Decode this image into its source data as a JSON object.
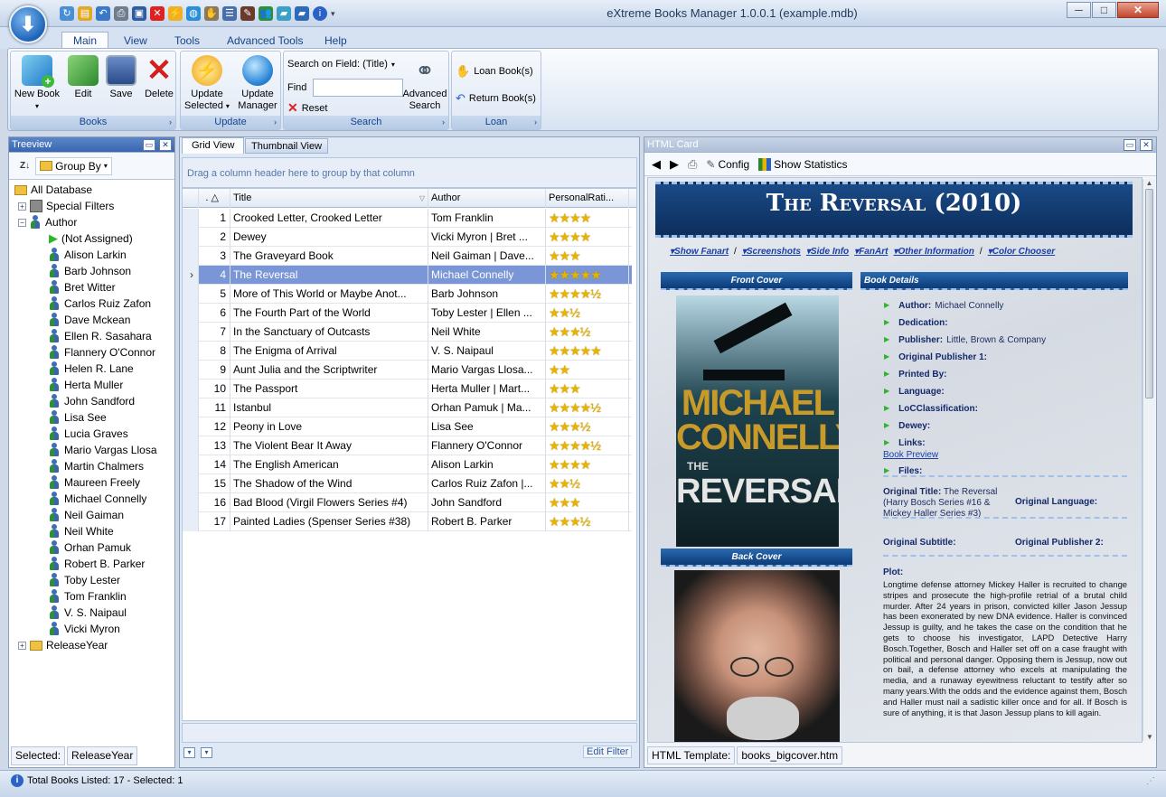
{
  "window": {
    "title": "eXtreme Books Manager 1.0.0.1 (example.mdb)",
    "minimize": "─",
    "maximize": "□",
    "close": "✕"
  },
  "ribbon": {
    "tabs": [
      "Main",
      "View",
      "Tools",
      "Advanced Tools",
      "Help"
    ],
    "groups": {
      "books": {
        "caption": "Books",
        "new_book": "New Book",
        "edit": "Edit",
        "save": "Save",
        "delete": "Delete"
      },
      "update": {
        "caption": "Update",
        "update_selected": "Update Selected",
        "update_manager": "Update Manager"
      },
      "search": {
        "caption": "Search",
        "field_label": "Search on Field: (Title)",
        "find_label": "Find",
        "find_value": "",
        "reset": "Reset",
        "advanced_search": "Advanced Search"
      },
      "loan": {
        "caption": "Loan",
        "loan_books": "Loan Book(s)",
        "return_books": "Return Book(s)"
      }
    }
  },
  "treeview": {
    "title": "Treeview",
    "group_by": "Group By",
    "nodes": {
      "all": "All Database",
      "special": "Special Filters",
      "author": "Author",
      "release": "ReleaseYear"
    },
    "authors": [
      "(Not Assigned)",
      "Alison Larkin",
      "Barb Johnson",
      "Bret Witter",
      "Carlos Ruiz Zafon",
      "Dave Mckean",
      "Ellen R. Sasahara",
      "Flannery O'Connor",
      "Helen R. Lane",
      "Herta Muller",
      "John Sandford",
      "Lisa See",
      "Lucia Graves",
      "Mario Vargas Llosa",
      "Martin Chalmers",
      "Maureen Freely",
      "Michael Connelly",
      "Neil Gaiman",
      "Neil White",
      "Orhan Pamuk",
      "Robert B. Parker",
      "Toby Lester",
      "Tom Franklin",
      "V. S. Naipaul",
      "Vicki Myron"
    ],
    "selected_label": "Selected:",
    "selected_value": "ReleaseYear"
  },
  "grid": {
    "tabs": [
      "Grid View",
      "Thumbnail View"
    ],
    "group_hint": "Drag a column header here to group by that column",
    "headers": {
      "num": ". △",
      "title": "Title",
      "author": "Author",
      "rating": "PersonalRati..."
    },
    "rows": [
      {
        "n": "1",
        "title": "Crooked Letter, Crooked Letter",
        "author": "Tom Franklin",
        "rating": "★★★★"
      },
      {
        "n": "2",
        "title": "Dewey",
        "author": "Vicki Myron | Bret ...",
        "rating": "★★★★"
      },
      {
        "n": "3",
        "title": "The Graveyard Book",
        "author": "Neil Gaiman | Dave...",
        "rating": "★★★"
      },
      {
        "n": "4",
        "title": "The Reversal",
        "author": "Michael Connelly",
        "rating": "★★★★★"
      },
      {
        "n": "5",
        "title": "More of This World or Maybe Anot...",
        "author": "Barb Johnson",
        "rating": "★★★★½"
      },
      {
        "n": "6",
        "title": "The Fourth Part of the World",
        "author": "Toby Lester | Ellen ...",
        "rating": "★★½"
      },
      {
        "n": "7",
        "title": "In the Sanctuary of Outcasts",
        "author": "Neil White",
        "rating": "★★★½"
      },
      {
        "n": "8",
        "title": "The Enigma of Arrival",
        "author": "V. S. Naipaul",
        "rating": "★★★★★"
      },
      {
        "n": "9",
        "title": "Aunt Julia and the Scriptwriter",
        "author": "Mario Vargas Llosa...",
        "rating": "★★"
      },
      {
        "n": "10",
        "title": "The Passport",
        "author": "Herta Muller | Mart...",
        "rating": "★★★"
      },
      {
        "n": "11",
        "title": "Istanbul",
        "author": "Orhan Pamuk | Ma...",
        "rating": "★★★★½"
      },
      {
        "n": "12",
        "title": "Peony in Love",
        "author": "Lisa See",
        "rating": "★★★½"
      },
      {
        "n": "13",
        "title": "The Violent Bear It Away",
        "author": "Flannery O'Connor",
        "rating": "★★★★½"
      },
      {
        "n": "14",
        "title": "The English American",
        "author": "Alison Larkin",
        "rating": "★★★★"
      },
      {
        "n": "15",
        "title": "The Shadow of the Wind",
        "author": "Carlos Ruiz Zafon |...",
        "rating": "★★½"
      },
      {
        "n": "16",
        "title": "Bad Blood (Virgil Flowers Series #4)",
        "author": "John Sandford",
        "rating": "★★★"
      },
      {
        "n": "17",
        "title": "Painted Ladies (Spenser Series #38)",
        "author": "Robert B. Parker",
        "rating": "★★★½"
      }
    ],
    "edit_filter": "Edit Filter"
  },
  "card": {
    "title": "HTML Card",
    "config": "Config",
    "show_statistics": "Show Statistics",
    "book_title": "The Reversal (2010)",
    "links": [
      "Show Fanart",
      "Screenshots",
      "Side Info",
      "FanArt",
      "Other Information",
      "Color Chooser"
    ],
    "front_cover": "Front Cover",
    "back_cover": "Back Cover",
    "cover_author": "MICHAEL CONNELLY",
    "cover_title": "REVERSAL",
    "cover_the": "THE",
    "book_details": "Book Details",
    "details": [
      {
        "label": "Author:",
        "value": "Michael Connelly"
      },
      {
        "label": "Dedication:",
        "value": ""
      },
      {
        "label": "Publisher:",
        "value": "Little, Brown & Company"
      },
      {
        "label": "Original Publisher 1:",
        "value": ""
      },
      {
        "label": "Printed By:",
        "value": ""
      },
      {
        "label": "Language:",
        "value": ""
      },
      {
        "label": "LoCClassification:",
        "value": ""
      },
      {
        "label": "Dewey:",
        "value": ""
      },
      {
        "label": "Links:",
        "value": ""
      }
    ],
    "book_preview": "Book Preview",
    "files": "Files:",
    "orig_title_label": "Original Title:",
    "orig_title_value": "The Reversal (Harry Bosch Series #16 & Mickey Haller Series #3)",
    "orig_language": "Original Language:",
    "orig_subtitle": "Original Subtitle:",
    "orig_publisher2": "Original Publisher 2:",
    "plot_label": "Plot:",
    "plot": "Longtime defense attorney Mickey Haller is recruited to change stripes and prosecute the high-profile retrial of a brutal child murder. After 24 years in prison, convicted killer Jason Jessup has been exonerated by new DNA evidence. Haller is convinced Jessup is guilty, and he takes the case on the condition that he gets to choose his investigator, LAPD Detective Harry Bosch.Together, Bosch and Haller set off on a case fraught with political and personal danger. Opposing them is Jessup, now out on bail, a defense attorney who excels at manipulating the media, and a runaway eyewitness reluctant to testify after so many years.With the odds and the evidence against them, Bosch and Haller must nail a sadistic killer once and for all. If Bosch is sure of anything, it is that Jason Jessup plans to kill again.",
    "template_label": "HTML Template:",
    "template_value": "books_bigcover.htm"
  },
  "status": {
    "text": "Total Books Listed: 17 - Selected: 1"
  }
}
